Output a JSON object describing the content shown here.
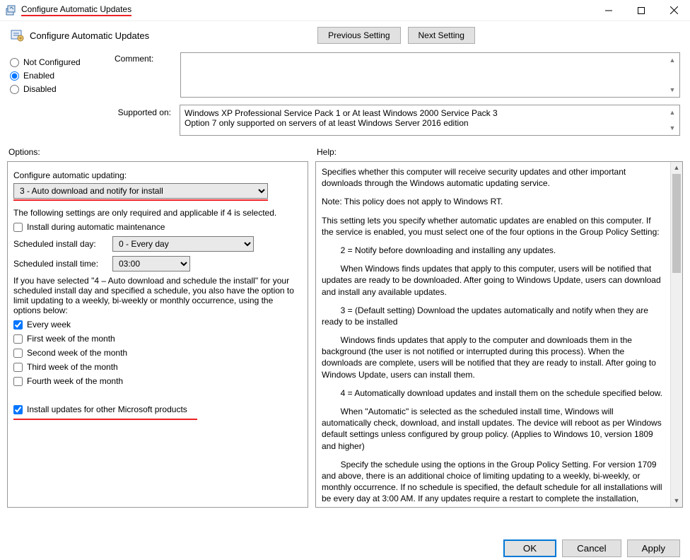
{
  "window": {
    "title": "Configure Automatic Updates"
  },
  "header": {
    "policy_title": "Configure Automatic Updates",
    "previous_setting": "Previous Setting",
    "next_setting": "Next Setting"
  },
  "state": {
    "not_configured": "Not Configured",
    "enabled": "Enabled",
    "disabled": "Disabled",
    "selected": "enabled"
  },
  "comment": {
    "label": "Comment:",
    "value": ""
  },
  "supported": {
    "label": "Supported on:",
    "line1": "Windows XP Professional Service Pack 1 or At least Windows 2000 Service Pack 3",
    "line2": "Option 7 only supported on servers of at least Windows Server 2016 edition"
  },
  "columns": {
    "options_label": "Options:",
    "help_label": "Help:"
  },
  "options": {
    "configure_label": "Configure automatic updating:",
    "configure_value": "3 - Auto download and notify for install",
    "note_required": "The following settings are only required and applicable if 4 is selected.",
    "install_maintenance": "Install during automatic maintenance",
    "scheduled_day_label": "Scheduled install day:",
    "scheduled_day_value": "0 - Every day",
    "scheduled_time_label": "Scheduled install time:",
    "scheduled_time_value": "03:00",
    "schedule_note": "If you have selected \"4 – Auto download and schedule the install\" for your scheduled install day and specified a schedule, you also have the option to limit updating to a weekly, bi-weekly or monthly occurrence, using the options below:",
    "every_week": "Every week",
    "first_week": "First week of the month",
    "second_week": "Second week of the month",
    "third_week": "Third week of the month",
    "fourth_week": "Fourth week of the month",
    "other_products": "Install updates for other Microsoft products"
  },
  "help": {
    "p1": "Specifies whether this computer will receive security updates and other important downloads through the Windows automatic updating service.",
    "p2": "Note: This policy does not apply to Windows RT.",
    "p3": "This setting lets you specify whether automatic updates are enabled on this computer. If the service is enabled, you must select one of the four options in the Group Policy Setting:",
    "p4": "        2 = Notify before downloading and installing any updates.",
    "p5": "        When Windows finds updates that apply to this computer, users will be notified that updates are ready to be downloaded. After going to Windows Update, users can download and install any available updates.",
    "p6": "        3 = (Default setting) Download the updates automatically and notify when they are ready to be installed",
    "p7": "        Windows finds updates that apply to the computer and downloads them in the background (the user is not notified or interrupted during this process). When the downloads are complete, users will be notified that they are ready to install. After going to Windows Update, users can install them.",
    "p8": "        4 = Automatically download updates and install them on the schedule specified below.",
    "p9": "        When \"Automatic\" is selected as the scheduled install time, Windows will automatically check, download, and install updates. The device will reboot as per Windows default settings unless configured by group policy. (Applies to Windows 10, version 1809 and higher)",
    "p10": "        Specify the schedule using the options in the Group Policy Setting. For version 1709 and above, there is an additional choice of limiting updating to a weekly, bi-weekly, or monthly occurrence. If no schedule is specified, the default schedule for all installations will be every day at 3:00 AM. If any updates require a restart to complete the installation, Windows will restart the"
  },
  "buttons": {
    "ok": "OK",
    "cancel": "Cancel",
    "apply": "Apply"
  }
}
